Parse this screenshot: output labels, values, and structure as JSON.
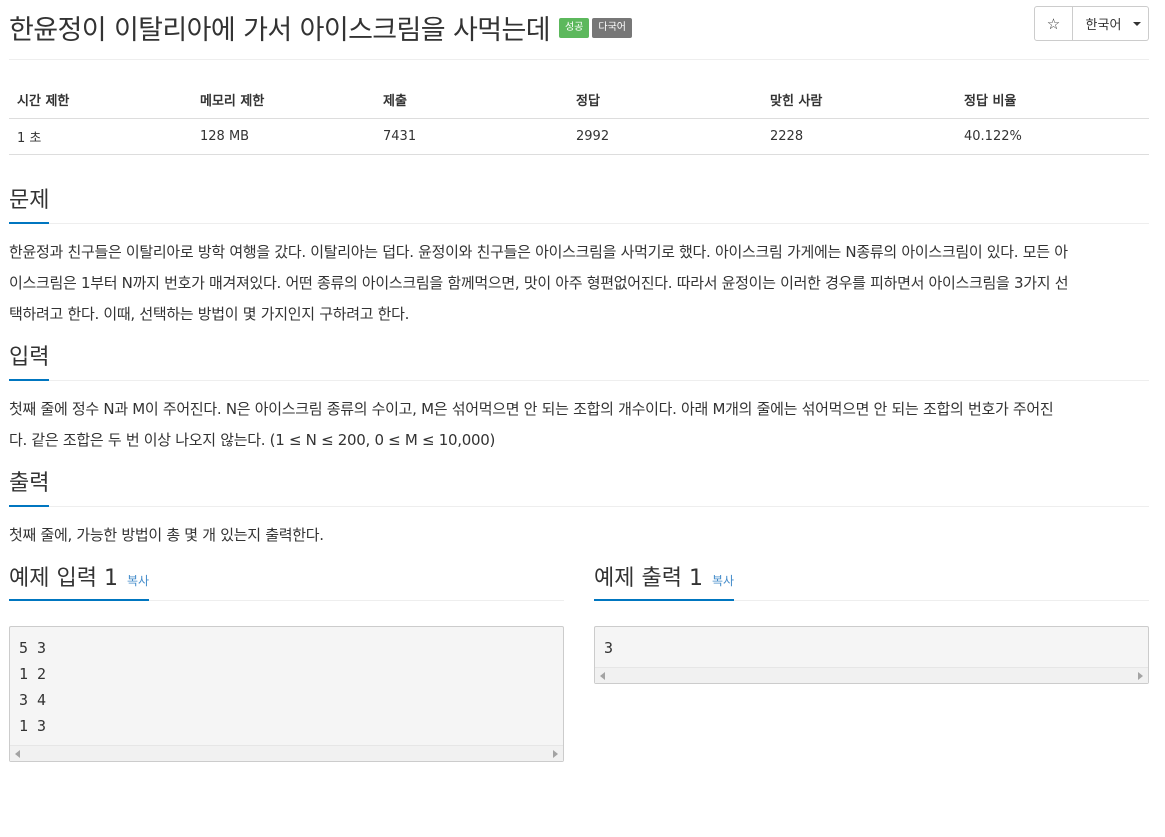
{
  "problem": {
    "title": "한윤정이 이탈리아에 가서 아이스크림을 사먹는데",
    "badges": {
      "success": "성공",
      "multilang": "다국어"
    }
  },
  "toolbar": {
    "star_icon": "☆",
    "language": "한국어"
  },
  "stats": {
    "headers": [
      "시간 제한",
      "메모리 제한",
      "제출",
      "정답",
      "맞힌 사람",
      "정답 비율"
    ],
    "values": [
      "1 초",
      "128 MB",
      "7431",
      "2992",
      "2228",
      "40.122%"
    ]
  },
  "sections": {
    "problem": {
      "heading": "문제",
      "lines": [
        "한윤정과 친구들은 이탈리아로 방학 여행을 갔다. 이탈리아는 덥다. 윤정이와 친구들은 아이스크림을 사먹기로 했다. 아이스크림 가게에는 N종류의 아이스크림이 있다. 모든 아",
        "이스크림은 1부터 N까지 번호가 매겨져있다. 어떤 종류의 아이스크림을 함께먹으면, 맛이 아주 형편없어진다. 따라서 윤정이는 이러한 경우를 피하면서 아이스크림을 3가지 선",
        "택하려고 한다. 이때, 선택하는 방법이 몇 가지인지 구하려고 한다."
      ]
    },
    "input": {
      "heading": "입력",
      "lines": [
        "첫째 줄에 정수 N과 M이 주어진다. N은 아이스크림 종류의 수이고, M은 섞어먹으면 안 되는 조합의 개수이다. 아래 M개의 줄에는 섞어먹으면 안 되는 조합의 번호가 주어진",
        "다. 같은 조합은 두 번 이상 나오지 않는다. (1 ≤ N ≤ 200, 0 ≤ M ≤ 10,000)"
      ]
    },
    "output": {
      "heading": "출력",
      "lines": [
        "첫째 줄에, 가능한 방법이 총 몇 개 있는지 출력한다."
      ]
    }
  },
  "samples": {
    "input": {
      "heading": "예제 입력 1",
      "copy_label": "복사",
      "lines": [
        "5 3",
        "1 2",
        "3 4",
        "1 3"
      ]
    },
    "output": {
      "heading": "예제 출력 1",
      "copy_label": "복사",
      "lines": [
        "3"
      ]
    }
  }
}
